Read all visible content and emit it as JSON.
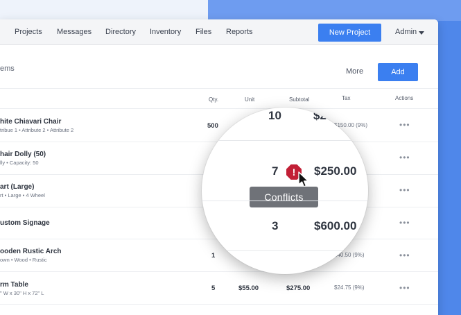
{
  "nav": {
    "items": [
      "Projects",
      "Messages",
      "Directory",
      "Inventory",
      "Files",
      "Reports"
    ],
    "new_project": "New Project",
    "admin": "Admin"
  },
  "card": {
    "title": "ems",
    "more": "More",
    "add": "Add"
  },
  "table": {
    "headers": {
      "qty": "Qty.",
      "unit": "Unit",
      "subtotal": "Subtotal",
      "tax": "Tax",
      "actions": "Actions"
    },
    "rows": [
      {
        "title": "hite Chiavari Chair",
        "sub": "tribue 1  •  Attribute 2  •  Attribute 2",
        "qty": "500",
        "unit": "",
        "subtotal": "",
        "tax": "$150.00 (9%)"
      },
      {
        "title": "hair Dolly (50)",
        "sub": "lly  •  Capacity: 50",
        "qty": "",
        "unit": "",
        "subtotal": "",
        "tax": ""
      },
      {
        "title": "art (Large)",
        "sub": "rt  •  Large  •  4 Wheel",
        "qty": "",
        "unit": "",
        "subtotal": "",
        "tax": ""
      },
      {
        "title": "ustom Signage",
        "sub": "",
        "qty": "",
        "unit": "",
        "subtotal": "",
        "tax": ""
      },
      {
        "title": "ooden Rustic Arch",
        "sub": "own  •  Wood  •  Rustic",
        "qty": "1",
        "unit": "",
        "subtotal": "",
        "tax": "$40.50 (9%)"
      },
      {
        "title": "rm Table",
        "sub": "\" W x 30\" H x 72\" L",
        "qty": "5",
        "unit": "$55.00",
        "subtotal": "$275.00",
        "tax": "$24.75 (9%)"
      }
    ],
    "action_icon": "•••"
  },
  "magnifier": {
    "row1_qty": "10",
    "row1_sub": "$2",
    "row2_qty": "7",
    "row2_sub": "$250.00",
    "tooltip": "Conflicts",
    "row3_qty": "3",
    "row3_sub": "$600.00",
    "warning_icon": "!"
  }
}
